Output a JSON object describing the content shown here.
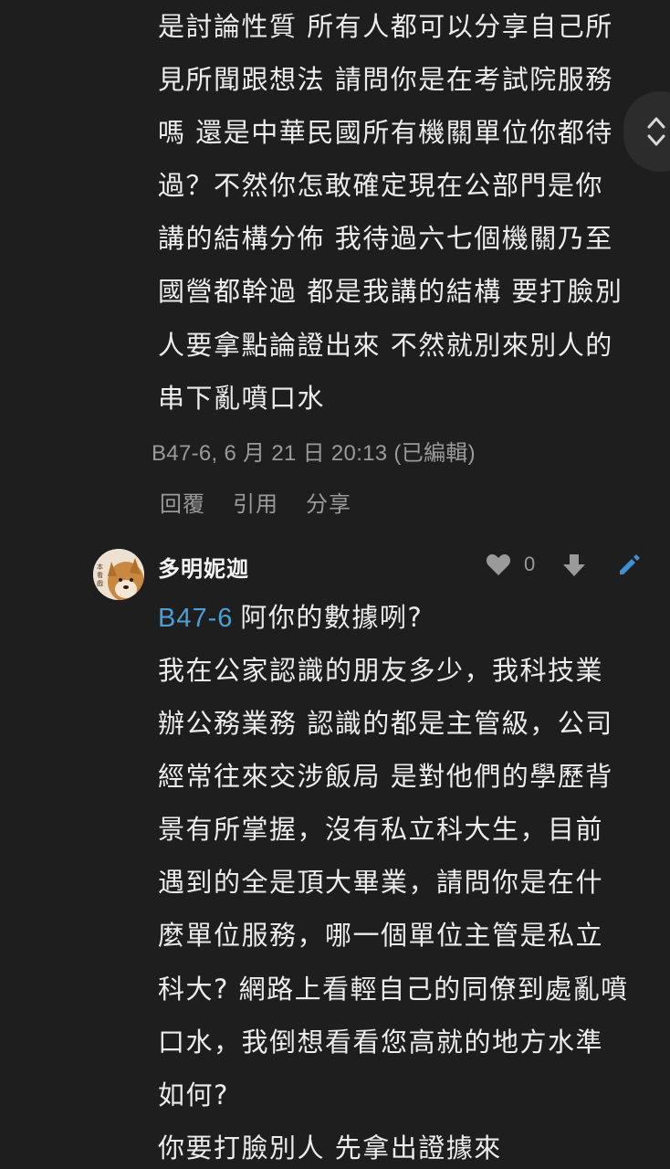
{
  "post1": {
    "lines": [
      "是討論性質 所有人都可以分享自己所",
      "見所聞跟想法 請問你是在考試院服務",
      "嗎 還是中華民國所有機關單位你都待",
      "過？不然你怎敢確定現在公部門是你",
      "講的結構分佈 我待過六七個機關乃至",
      "國營都幹過 都是我講的結構 要打臉別",
      "人要拿點論證出來 不然就別來別人的",
      "串下亂噴口水"
    ],
    "meta": "B47-6, 6 月 21 日 20:13 (已編輯)",
    "actions": {
      "reply": "回覆",
      "quote": "引用",
      "share": "分享"
    }
  },
  "post2": {
    "username": "多明妮迦",
    "avatar_text": "本看戲",
    "like_count": "0",
    "quote_ref": "B47-6",
    "quote_text": "阿你的數據咧?",
    "lines": [
      "我在公家認識的朋友多少，我科技業",
      "辦公務業務 認識的都是主管級，公司",
      "經常往來交涉飯局 是對他們的學歷背",
      "景有所掌握，沒有私立科大生，目前",
      "遇到的全是頂大畢業，請問你是在什",
      "麼單位服務，哪一個單位主管是私立",
      "科大? 網路上看輕自己的同僚到處亂噴",
      "口水，我倒想看看您高就的地方水準",
      "如何?",
      "你要打臉別人 先拿出證據來"
    ]
  },
  "icons": {
    "like": "heart-icon",
    "download": "arrow-down-icon",
    "edit": "pencil-icon",
    "scroll": "up-down-chevron-icon"
  },
  "colors": {
    "background": "#1e1e1e",
    "text": "#ececec",
    "muted": "#9a9a9a",
    "link": "#4a9fd4",
    "edit_icon": "#3d8fd6"
  }
}
